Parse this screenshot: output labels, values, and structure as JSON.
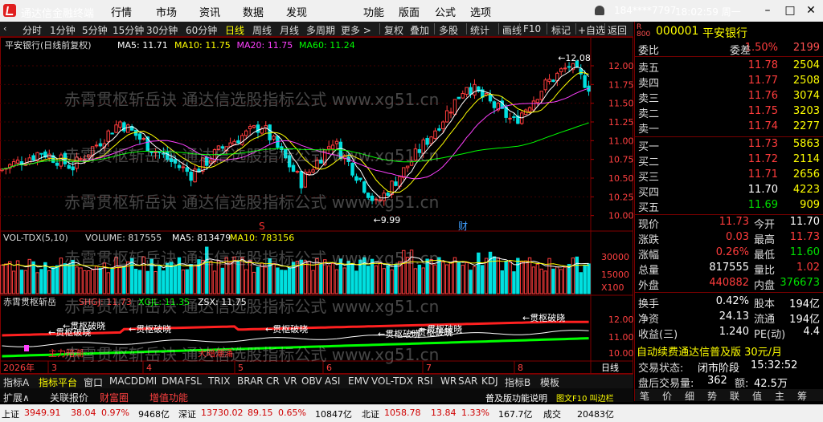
{
  "app": {
    "title": "通达信金融终端",
    "menus": [
      "行情",
      "市场",
      "资讯",
      "数据",
      "发现",
      "功能",
      "版面",
      "公式",
      "选项"
    ],
    "account": "184****7797",
    "clock": "18:02:59 周一",
    "win": [
      "–",
      "□",
      "✕"
    ]
  },
  "toolbar": {
    "periods": [
      "分时",
      "1分钟",
      "5分钟",
      "15分钟",
      "30分钟",
      "60分钟",
      "日线",
      "周线",
      "月线",
      "多周期",
      "更多 >"
    ],
    "tools": [
      "复权",
      "叠加",
      "多股",
      "统计",
      "画线",
      "F10",
      "标记",
      "+自选",
      "返回"
    ]
  },
  "main_chart": {
    "header": "平安银行(日线前复权)",
    "ma_labels": [
      {
        "t": "MA5: 11.71",
        "c": "#ffffff"
      },
      {
        "t": "MA10: 11.75",
        "c": "#ffff00"
      },
      {
        "t": "MA20: 11.75",
        "c": "#ff40ff"
      },
      {
        "t": "MA60: 11.24",
        "c": "#00ff00"
      }
    ],
    "price_ticks": [
      "12.00",
      "11.75",
      "11.50",
      "11.25",
      "11.00",
      "10.75",
      "10.50",
      "10.25",
      "10.00"
    ],
    "high_label": "12.08",
    "low_label": "9.99",
    "marker_s": "S",
    "marker_cai": "财",
    "vol_header": "VOL-TDX(5,10)",
    "vol_main": "VOLUME: 817555",
    "vol_ma5": "MA5: 813479",
    "vol_ma10": "MA10: 783156",
    "vol_ticks": [
      "30000",
      "15000",
      "X100"
    ],
    "ind_header": "赤霄贯枢斩岳",
    "ind_a": "SHGJ: 11.73",
    "ind_b": "XGJL: 11.35",
    "ind_c": "ZSX: 11.75",
    "ind_ticks": [
      "12.00",
      "11.00",
      "10.00"
    ],
    "ind_tags": [
      "贯枢破晓",
      "贯枢破晓",
      "贯枢破晓",
      "贯枢破晓",
      "贯枢破晓",
      "贯枢破晓",
      "贯枢破晓",
      "贯枢破晓"
    ],
    "ind_tag_red": "主力暗潮",
    "ind_tag_red2": "大暗潮涌",
    "dates": [
      "2026年",
      "3",
      "4",
      "5",
      "6",
      "7",
      "8",
      "9"
    ],
    "period_label": "日线",
    "watermark": "赤霄贯枢斩岳诀 通达信选股指标公式 www.xg51.cn"
  },
  "bottom_tabs": [
    "指标A",
    "指标平台",
    "窗口",
    "MACD",
    "DMI",
    "DMA",
    "FSL",
    "TRIX",
    "BRAR",
    "CR",
    "VR",
    "OBV",
    "ASI",
    "EMV",
    "VOL-TDX",
    "RSI",
    "WR",
    "SAR",
    "KDJ",
    "指标B",
    "模板"
  ],
  "row2": {
    "expand": "扩展∧",
    "items": [
      "关联报价",
      "财富圈",
      "增值功能"
    ]
  },
  "quote": {
    "code": "000001",
    "name": "平安银行",
    "weibi_label": "委比",
    "weibi": "1.50%",
    "weicha_label": "委差",
    "weicha": "2199",
    "asks": [
      {
        "l": "卖五",
        "p": "11.78",
        "v": "2504"
      },
      {
        "l": "卖四",
        "p": "11.77",
        "v": "2508"
      },
      {
        "l": "卖三",
        "p": "11.76",
        "v": "3074"
      },
      {
        "l": "卖二",
        "p": "11.75",
        "v": "3203"
      },
      {
        "l": "卖一",
        "p": "11.74",
        "v": "2277"
      }
    ],
    "bids": [
      {
        "l": "买一",
        "p": "11.73",
        "v": "5863"
      },
      {
        "l": "买二",
        "p": "11.72",
        "v": "2114"
      },
      {
        "l": "买三",
        "p": "11.71",
        "v": "2656"
      },
      {
        "l": "买四",
        "p": "11.70",
        "v": "4223"
      },
      {
        "l": "买五",
        "p": "11.69",
        "v": "909"
      }
    ],
    "stats": [
      {
        "a": "现价",
        "av": "11.73",
        "ac": "#ff3c3c",
        "b": "今开",
        "bv": "11.70",
        "bc": "#ffffff"
      },
      {
        "a": "涨跌",
        "av": "0.03",
        "ac": "#ff3c3c",
        "b": "最高",
        "bv": "11.73",
        "bc": "#ff3c3c"
      },
      {
        "a": "涨幅",
        "av": "0.26%",
        "ac": "#ff3c3c",
        "b": "最低",
        "bv": "11.60",
        "bc": "#00e000"
      },
      {
        "a": "总量",
        "av": "817555",
        "ac": "#ffffff",
        "b": "量比",
        "bv": "1.02",
        "bc": "#ff3c3c"
      },
      {
        "a": "外盘",
        "av": "440882",
        "ac": "#ff3c3c",
        "b": "内盘",
        "bv": "376673",
        "bc": "#00e000"
      },
      {
        "a": "换手",
        "av": "0.42%",
        "ac": "#ffffff",
        "b": "股本",
        "bv": "194亿",
        "bc": "#ffffff"
      },
      {
        "a": "净资",
        "av": "24.13",
        "ac": "#ffffff",
        "b": "流通",
        "bv": "194亿",
        "bc": "#ffffff"
      },
      {
        "a": "收益(三)",
        "av": "1.240",
        "ac": "#ffffff",
        "b": "PE(动)",
        "bv": "4.4",
        "bc": "#ffffff"
      }
    ],
    "ad": "自动续费通达信普及版 30元/月",
    "trade_state_label": "交易状态:",
    "trade_state": "闭市阶段",
    "trade_time": "15:32:52",
    "block_label": "盘后交易量:",
    "block_val": "362",
    "amount_label": "额:",
    "amount_val": "42.5万",
    "tabs": [
      "笔",
      "价",
      "细",
      "势",
      "联",
      "值",
      "主",
      "筹"
    ]
  },
  "status": {
    "sh": "上证",
    "sh_v": "3949.91",
    "sh_c": "38.04",
    "sh_p": "0.97%",
    "sh_a": "9468亿",
    "sz": "深证",
    "sz_v": "13730.02",
    "sz_c": "89.15",
    "sz_p": "0.65%",
    "sz_a": "10847亿",
    "bz": "北证",
    "bz_v": "1058.78",
    "bz_c": "13.84",
    "bz_p": "1.33%",
    "bz_a": "167.7亿",
    "total_label": "成交",
    "total": "20483亿",
    "help": "普及版功能说明",
    "f10": "图文F10 叫边栏"
  },
  "colors": {
    "up": "#ff3c3c",
    "down": "#00e0e0",
    "ma5": "#ffffff",
    "ma10": "#ffff00",
    "ma20": "#ff40ff",
    "ma60": "#00ff00"
  },
  "chart_data": {
    "type": "candlestick",
    "ylim": [
      9.9,
      12.15
    ],
    "ohlc": [],
    "volume": []
  }
}
